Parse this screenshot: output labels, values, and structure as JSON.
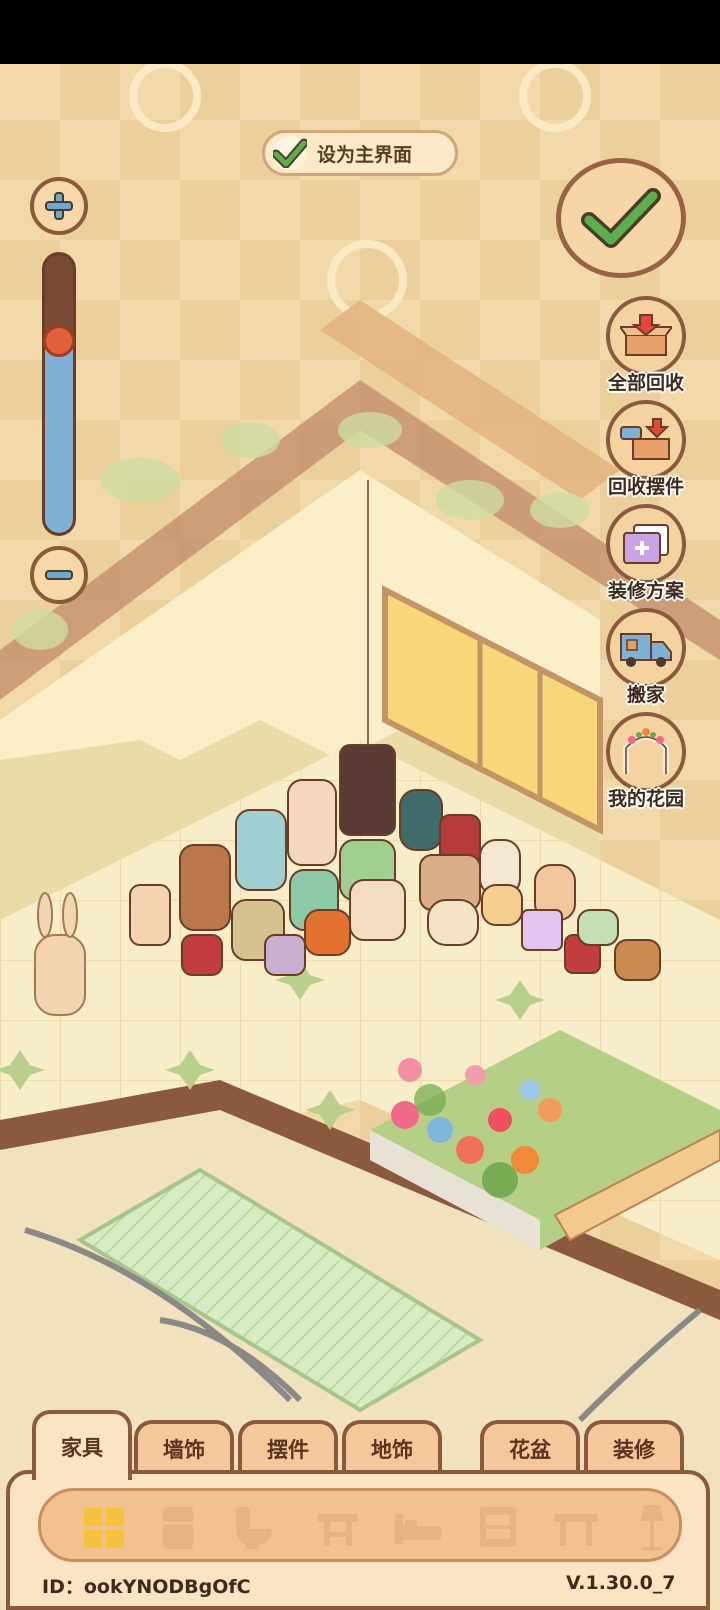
{
  "top_toggle": {
    "label": "设为主界面",
    "checked": true
  },
  "zoom": {
    "level_fraction": 0.68
  },
  "side_menu": [
    {
      "label": "全部回收",
      "icon": "recycle-all-icon"
    },
    {
      "label": "回收摆件",
      "icon": "recycle-ornaments-icon"
    },
    {
      "label": "装修方案",
      "icon": "decoration-plan-icon"
    },
    {
      "label": "搬家",
      "icon": "moving-truck-icon"
    },
    {
      "label": "我的花园",
      "icon": "garden-arch-icon"
    }
  ],
  "tabs": [
    {
      "label": "家具",
      "active": true
    },
    {
      "label": "墙饰",
      "active": false
    },
    {
      "label": "摆件",
      "active": false
    },
    {
      "label": "地饰",
      "active": false
    },
    {
      "label": "花盆",
      "active": false
    },
    {
      "label": "装修",
      "active": false
    }
  ],
  "categories": [
    "all-grid-icon",
    "fridge-icon",
    "toilet-icon",
    "stool-icon",
    "bed-icon",
    "cabinet-icon",
    "table-icon",
    "lamp-icon"
  ],
  "footer": {
    "id_text": "ID：ookYNODBgOfC",
    "version": "V.1.30.0_7"
  },
  "colors": {
    "accent_green": "#5ab04a",
    "frame_brown": "#8b5a3e"
  }
}
